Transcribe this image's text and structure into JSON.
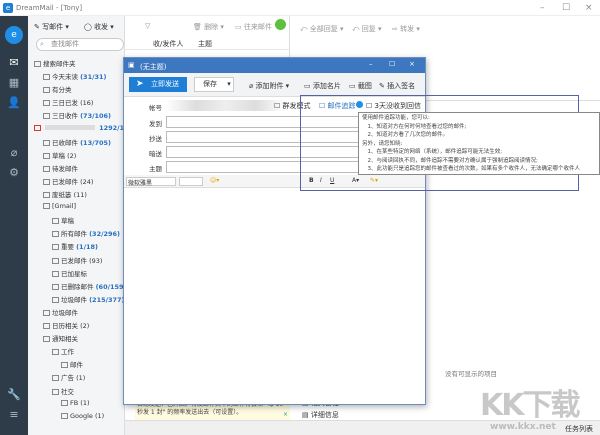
{
  "app": {
    "title": "DreamMail - [Tony]"
  },
  "rail": {
    "icons": [
      "logo-icon",
      "mail-icon",
      "calendar-icon",
      "contacts-icon",
      "attachment-icon",
      "settings-icon",
      "tools-icon",
      "menu-icon"
    ]
  },
  "toolbar": {
    "compose": "写邮件",
    "receive": "收发",
    "delete": "删除",
    "offline": "往来邮件"
  },
  "search": {
    "placeholder": "查找邮件"
  },
  "folders": [
    {
      "label": "搜索邮件夹",
      "count": "",
      "indent": 0
    },
    {
      "label": "今天未读",
      "count": "(31/31)",
      "indent": 1
    },
    {
      "label": "有分类",
      "count": "",
      "indent": 1
    },
    {
      "label": "三日已发",
      "count": "(16)",
      "indent": 1,
      "plain": true
    },
    {
      "label": "三日收件",
      "count": "(73/106)",
      "indent": 1
    },
    {
      "label": "",
      "count": "1292/1451",
      "indent": 0
    },
    {
      "label": "已收邮件",
      "count": "(13/705)",
      "indent": 1
    },
    {
      "label": "草稿",
      "count": "(2)",
      "indent": 1,
      "plain": true
    },
    {
      "label": "待发邮件",
      "count": "",
      "indent": 1
    },
    {
      "label": "已发邮件",
      "count": "(24)",
      "indent": 1,
      "plain": true
    },
    {
      "label": "废纸篓",
      "count": "(11)",
      "indent": 1,
      "plain": true
    },
    {
      "label": "[Gmail]",
      "count": "",
      "indent": 1
    },
    {
      "label": "草稿",
      "count": "",
      "indent": 2
    },
    {
      "label": "所有邮件",
      "count": "(32/296)",
      "indent": 2
    },
    {
      "label": "重要",
      "count": "(1/18)",
      "indent": 2
    },
    {
      "label": "已发邮件",
      "count": "(93)",
      "indent": 2,
      "plain": true
    },
    {
      "label": "已加星标",
      "count": "",
      "indent": 2
    },
    {
      "label": "已删除邮件",
      "count": "(60/159)",
      "indent": 2
    },
    {
      "label": "垃圾邮件",
      "count": "(215/377)",
      "indent": 2
    },
    {
      "label": "垃圾邮件",
      "count": "",
      "indent": 1
    },
    {
      "label": "日历相关",
      "count": "(2)",
      "indent": 1,
      "plain": true
    },
    {
      "label": "通知相关",
      "count": "",
      "indent": 1
    },
    {
      "label": "工作",
      "count": "",
      "indent": 2
    },
    {
      "label": "邮件",
      "count": "",
      "indent": 3
    },
    {
      "label": "广告",
      "count": "(1)",
      "indent": 2,
      "plain": true
    },
    {
      "label": "社交",
      "count": "",
      "indent": 2
    },
    {
      "label": "FB",
      "count": "(1)",
      "indent": 3,
      "plain": true
    },
    {
      "label": "Google",
      "count": "(1)",
      "indent": 3,
      "plain": true
    }
  ],
  "list": {
    "col_sender": "收/发件人",
    "col_subject": "主题"
  },
  "reader": {
    "reply_all": "全部回复",
    "reply": "回复",
    "forward": "转发",
    "empty": "没有可显示的项目",
    "related": "相关日程",
    "details": "详细信息"
  },
  "compose": {
    "title": "(无主题)",
    "send": "立即发送",
    "save": "保存",
    "attach": "添加附件",
    "card": "添加名片",
    "screenshot": "截图",
    "signature": "插入签名",
    "account_label": "帐号",
    "to_label": "发到",
    "cc_label": "抄送",
    "bcc_label": "暗送",
    "subject_label": "主题",
    "mass": "群发模式",
    "tracking": "邮件追踪",
    "remind": "3天没收到回信提醒",
    "font": "微软雅黑"
  },
  "tooltip": {
    "lines": [
      "使用邮件追踪功能，您可以:",
      "　1、知道对方在何时何地查看过您的邮件;",
      "　2、知道对方看了几次您的邮件。",
      "另外，请您知晓:",
      "　1、在某些特定的网络（系统），邮件追踪可能无法生效;",
      "　2、与阅读回执不同，邮件追踪不需要对方确认属于强制追踪阅读情况;",
      "　3、此功能只是追踪您的邮件被查看过的次数，如果有多个收件人，无法确定哪个收件人"
    ]
  },
  "notice": {
    "text": "自动发送：已开启。待发邮件夹中的邮件将会以 \"每 10 秒发 1 封\" 的频率发送出去（可设置）。"
  },
  "status": {
    "tasks": "任务列表"
  },
  "watermark": {
    "text": "KK下载",
    "url": "www.kkx.net"
  },
  "colors": {
    "accent": "#1f7fd6",
    "rail": "#2e3b48",
    "count": "#2a6fc0",
    "highlight": "#5b5fa8"
  }
}
